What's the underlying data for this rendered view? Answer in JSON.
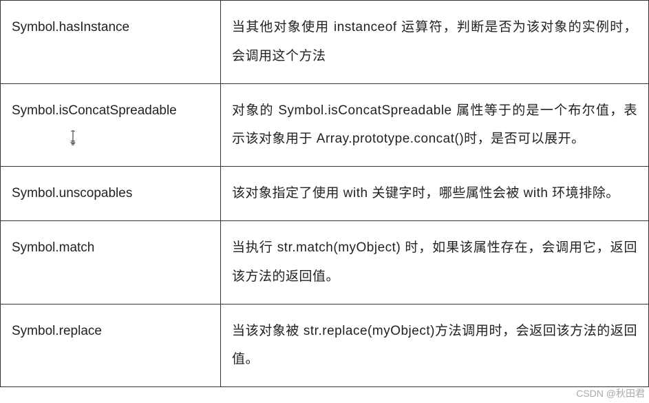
{
  "rows": [
    {
      "symbol": "Symbol.hasInstance",
      "description": "当其他对象使用 instanceof 运算符，判断是否为该对象的实例时，会调用这个方法"
    },
    {
      "symbol": "Symbol.isConcatSpreadable",
      "description": "对象的 Symbol.isConcatSpreadable 属性等于的是一个布尔值，表示该对象用于 Array.prototype.concat()时，是否可以展开。"
    },
    {
      "symbol": "Symbol.unscopables",
      "description": "该对象指定了使用 with 关键字时，哪些属性会被 with 环境排除。"
    },
    {
      "symbol": "Symbol.match",
      "description": "当执行 str.match(myObject) 时，如果该属性存在，会调用它，返回该方法的返回值。"
    },
    {
      "symbol": "Symbol.replace",
      "description": "当该对象被 str.replace(myObject)方法调用时，会返回该方法的返回值。"
    }
  ],
  "watermark": "CSDN @秋田君"
}
